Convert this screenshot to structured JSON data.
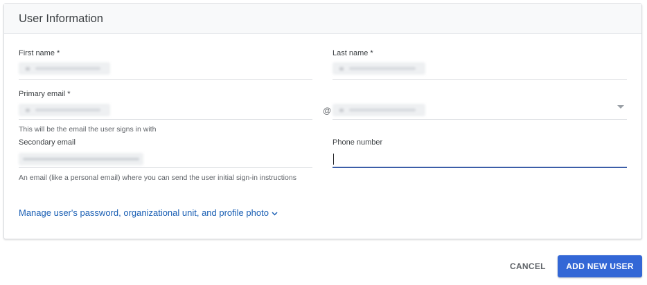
{
  "card": {
    "title": "User Information"
  },
  "fields": {
    "first_name": {
      "label": "First name *"
    },
    "last_name": {
      "label": "Last name *"
    },
    "primary_email": {
      "label": "Primary email *",
      "at": "@",
      "helper": "This will be the email the user signs in with"
    },
    "secondary_email": {
      "label": "Secondary email",
      "helper": "An email (like a personal email) where you can send the user initial sign-in instructions"
    },
    "phone": {
      "label": "Phone number",
      "value": ""
    }
  },
  "manage_link": {
    "text": "Manage user's password, organizational unit, and profile photo",
    "icon": "chevron-down-icon"
  },
  "actions": {
    "cancel": "CANCEL",
    "submit": "ADD NEW USER"
  },
  "colors": {
    "accent": "#3367d6",
    "link": "#1a5fb4",
    "active_underline": "#3c5ea8"
  }
}
